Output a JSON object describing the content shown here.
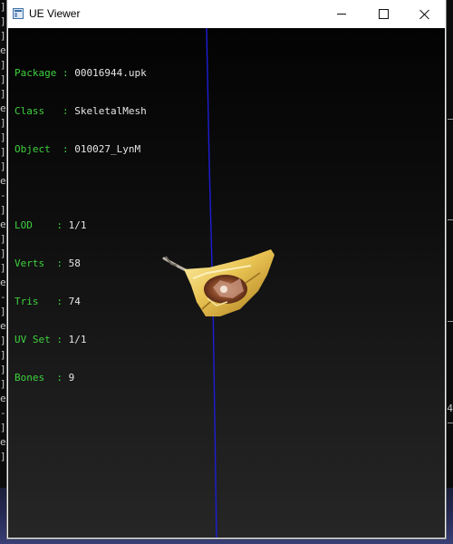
{
  "window": {
    "title": "UE Viewer"
  },
  "info": {
    "rows": [
      {
        "key": "Package",
        "val": "00016944.upk"
      },
      {
        "key": "Class",
        "val": "SkeletalMesh"
      },
      {
        "key": "Object",
        "val": "010027_LynM"
      },
      {
        "key": "LOD",
        "val": "1/1"
      },
      {
        "key": "Verts",
        "val": "58"
      },
      {
        "key": "Tris",
        "val": "74"
      },
      {
        "key": "UV Set",
        "val": "1/1"
      },
      {
        "key": "Bones",
        "val": "9"
      }
    ],
    "key_labels": [
      "Package : ",
      "Class   : ",
      "Object  : ",
      "LOD    : ",
      "Verts  : ",
      "Tris   : ",
      "UV Set : ",
      "Bones  : "
    ]
  },
  "background_console": {
    "left_glyphs": [
      "]",
      "]",
      "]",
      "e",
      "]",
      "]",
      "]",
      "e",
      "]",
      "]",
      "]",
      "]",
      "e",
      "-",
      "]",
      "e",
      "]",
      "]",
      "]",
      "e",
      "-",
      "]",
      "e",
      "]",
      "]",
      "]",
      "]",
      "e",
      "-",
      "]",
      "e",
      "]"
    ],
    "right_label": "4"
  },
  "colors": {
    "info_key": "#3ed13e",
    "info_value": "#e6e6e6",
    "axis_line": "#1d1dd6",
    "viewport_bg": "#1a1a1a"
  }
}
